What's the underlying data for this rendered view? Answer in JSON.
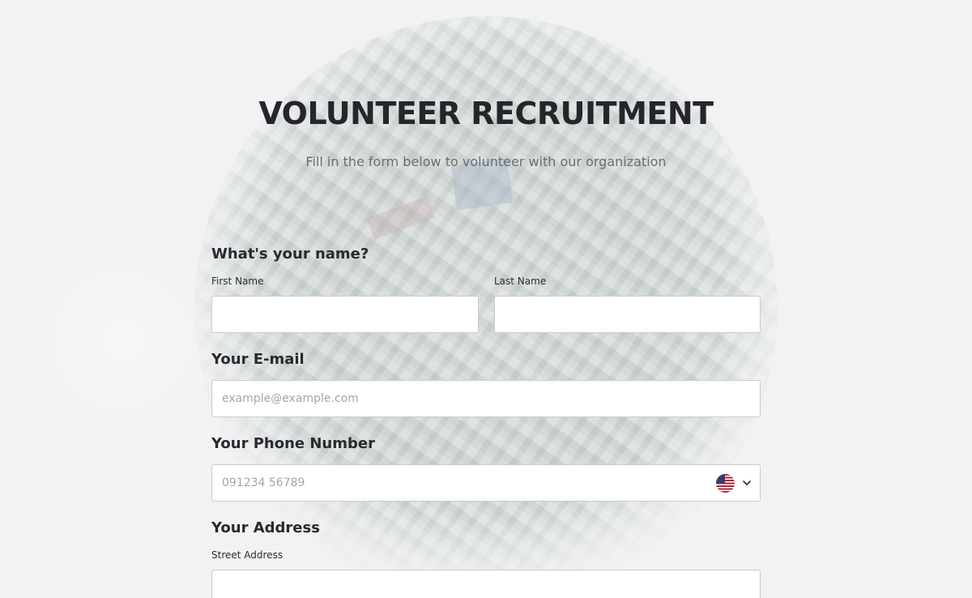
{
  "header": {
    "title": "VOLUNTEER RECRUITMENT",
    "subtitle": "Fill in the form below to volunteer with our organization"
  },
  "name_section": {
    "heading": "What's your name?",
    "first_name_label": "First Name",
    "first_name_value": "",
    "last_name_label": "Last Name",
    "last_name_value": ""
  },
  "email_section": {
    "heading": "Your E-mail",
    "placeholder": "example@example.com",
    "value": ""
  },
  "phone_section": {
    "heading": "Your Phone Number",
    "placeholder": "091234 56789",
    "value": "",
    "country_icon": "us-flag-icon"
  },
  "address_section": {
    "heading": "Your Address",
    "street_label": "Street Address",
    "street_value": ""
  }
}
